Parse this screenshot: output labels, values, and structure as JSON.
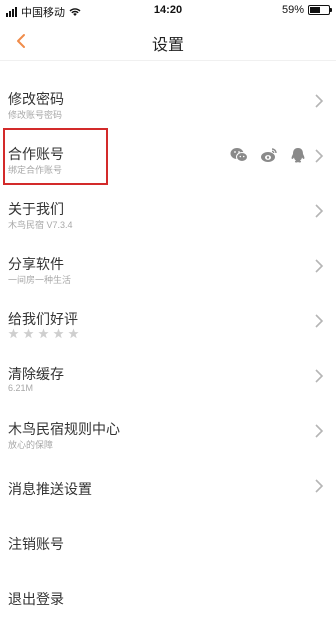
{
  "status_bar": {
    "carrier": "中国移动",
    "time": "14:20",
    "battery_percent": "59%",
    "battery_level": 0.59,
    "icons": [
      "signal-icon",
      "wifi-icon",
      "battery-icon"
    ]
  },
  "nav": {
    "back_icon": "chevron-left-icon",
    "title": "设置",
    "accent_color": "#f08c4a"
  },
  "settings": {
    "items": [
      {
        "title": "修改密码",
        "subtitle": "修改账号密码"
      },
      {
        "title": "合作账号",
        "subtitle": "绑定合作账号",
        "icons": [
          "wechat-icon",
          "weibo-icon",
          "qq-icon"
        ]
      },
      {
        "title": "关于我们",
        "subtitle": "木鸟民宿 V7.3.4"
      },
      {
        "title": "分享软件",
        "subtitle": "一间房一种生活"
      },
      {
        "title": "给我们好评",
        "rating_stars": 5
      },
      {
        "title": "清除缓存",
        "subtitle": "6.21M"
      },
      {
        "title": "木鸟民宿规则中心",
        "subtitle": "放心的保障"
      },
      {
        "title": "消息推送设置"
      },
      {
        "title": "注销账号"
      },
      {
        "title": "退出登录"
      }
    ]
  },
  "colors": {
    "highlight_border": "#d32a2a",
    "icon_gray": "#8a8a8a"
  }
}
